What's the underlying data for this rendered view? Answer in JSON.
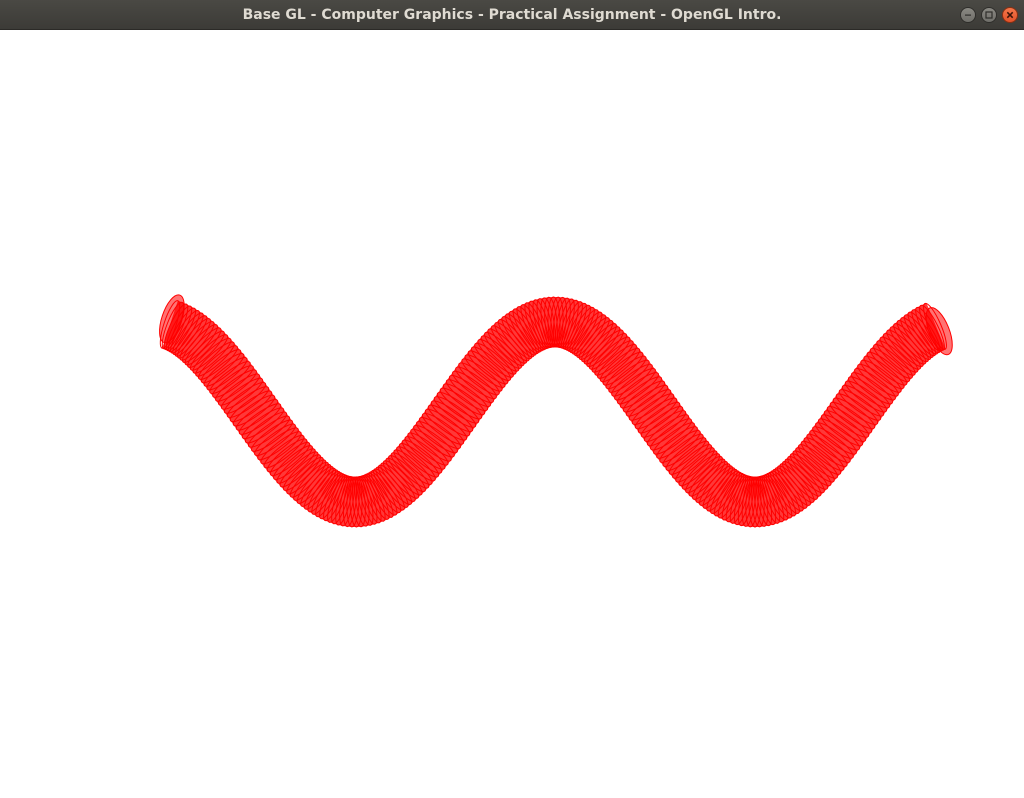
{
  "window": {
    "title": "Base GL - Computer Graphics - Practical Assignment - OpenGL Intro.",
    "controls": [
      "minimize-icon",
      "maximize-icon",
      "close-icon"
    ]
  },
  "scene": {
    "background_color": "#ffffff",
    "tube_color": "#ff0000",
    "render_mode": "wireframe",
    "object": "sinusoidal tube"
  }
}
